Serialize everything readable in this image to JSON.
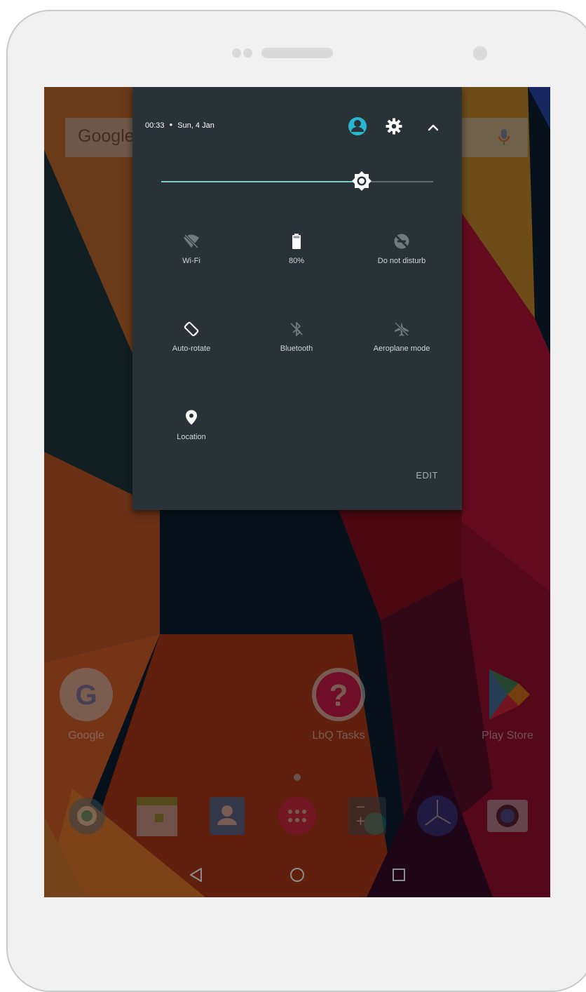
{
  "status": {
    "time": "00:33",
    "separator": "•",
    "date": "Sun, 4 Jan"
  },
  "header_icons": [
    {
      "name": "user-avatar-icon",
      "color": "#29b6d0"
    },
    {
      "name": "gear-icon",
      "color": "#ffffff"
    },
    {
      "name": "chevron-up-icon",
      "color": "#ffffff"
    }
  ],
  "brightness": {
    "level_fraction": 0.737,
    "accent": "#80cbc4"
  },
  "tiles": [
    {
      "label": "Wi-Fi",
      "icon": "wifi-off-icon",
      "active": false
    },
    {
      "label": "80%",
      "icon": "battery-icon",
      "active": true
    },
    {
      "label": "Do not disturb",
      "icon": "do-not-disturb-off-icon",
      "active": false
    },
    {
      "label": "Auto-rotate",
      "icon": "auto-rotate-icon",
      "active": true
    },
    {
      "label": "Bluetooth",
      "icon": "bluetooth-off-icon",
      "active": false
    },
    {
      "label": "Aeroplane mode",
      "icon": "airplane-off-icon",
      "active": false
    },
    {
      "label": "Location",
      "icon": "location-pin-icon",
      "active": true
    }
  ],
  "edit_label": "EDIT",
  "search": {
    "logo_text": "Google"
  },
  "home_apps": [
    {
      "label": "Google",
      "icon": "google-app-icon"
    },
    {
      "label": "LbQ Tasks",
      "icon": "lbq-tasks-icon"
    },
    {
      "label": "Play Store",
      "icon": "play-store-icon"
    }
  ],
  "dock": [
    {
      "icon": "settings-app-icon"
    },
    {
      "icon": "calendar-app-icon"
    },
    {
      "icon": "contacts-app-icon"
    },
    {
      "icon": "app-drawer-icon"
    },
    {
      "icon": "calculator-app-icon"
    },
    {
      "icon": "clock-app-icon"
    },
    {
      "icon": "camera-app-icon"
    }
  ],
  "nav": [
    {
      "icon": "back-icon"
    },
    {
      "icon": "home-icon"
    },
    {
      "icon": "recents-icon"
    }
  ]
}
